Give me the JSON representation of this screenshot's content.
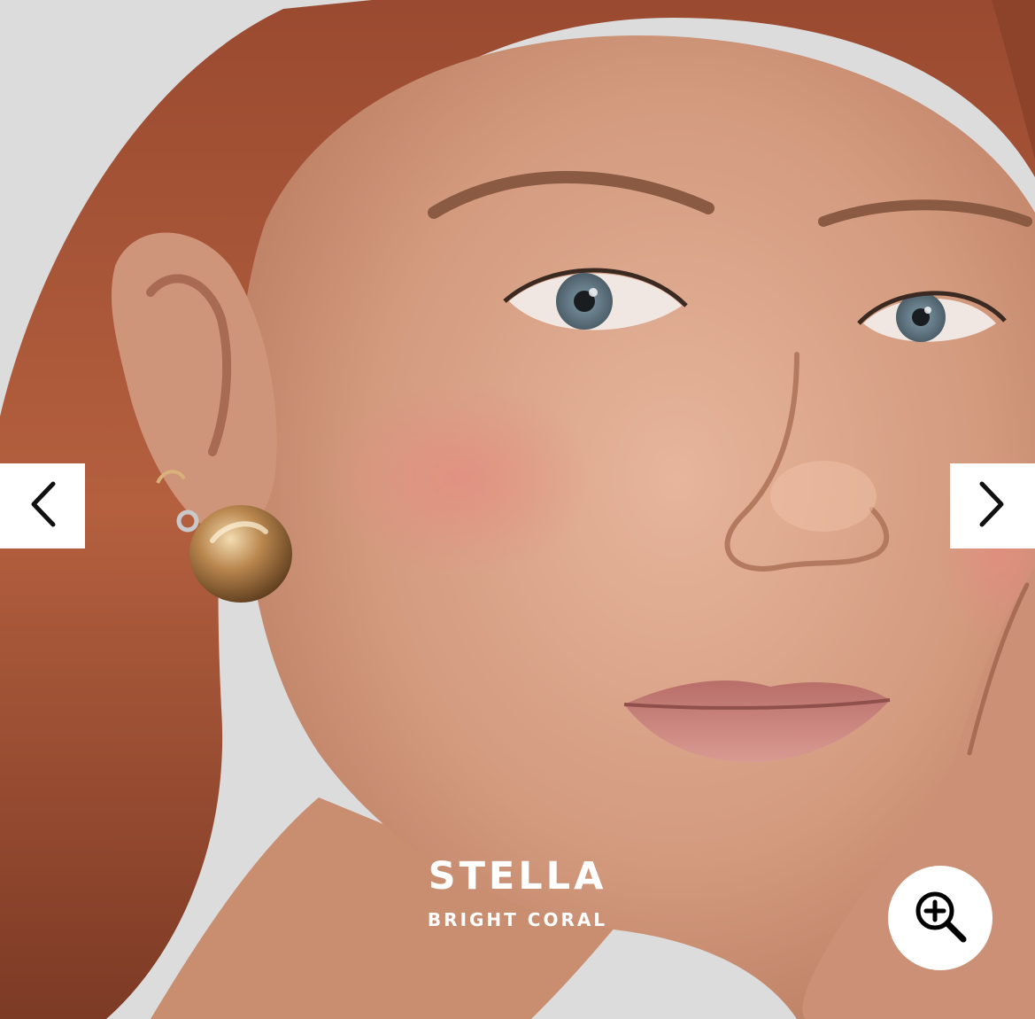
{
  "gallery": {
    "product_name": "STELLA",
    "shade_name": "BRIGHT CORAL",
    "prev_icon": "chevron-left-icon",
    "next_icon": "chevron-right-icon",
    "zoom_icon": "zoom-in-icon"
  },
  "colors": {
    "background": "#dcdcdd",
    "hair": "#a8553a",
    "skin": "#d9a58a",
    "blush": "#e08a7e",
    "earring": "#c79a5e",
    "button": "#ffffff",
    "caption_text": "#ffffff"
  }
}
